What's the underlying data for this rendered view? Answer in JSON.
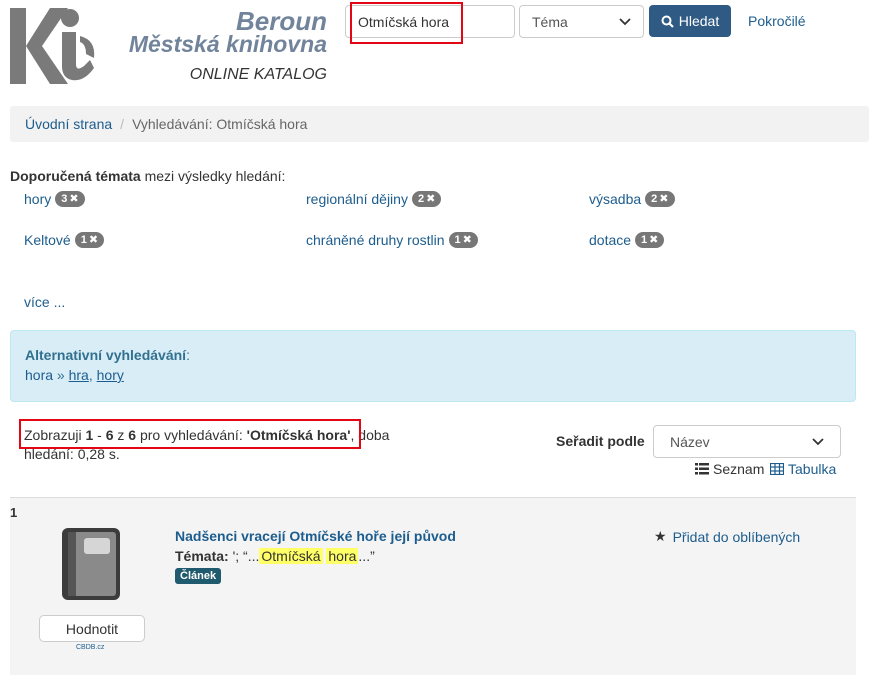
{
  "brand": {
    "city": "Beroun",
    "library": "Městská knihovna",
    "subtitle": "ONLINE KATALOG"
  },
  "search": {
    "query": "Otmíčská hora",
    "index_selected": "Téma",
    "submit_label": "Hledat",
    "advanced_label": "Pokročilé"
  },
  "breadcrumb": {
    "home": "Úvodní strana",
    "separator": "/",
    "current": "Vyhledávání: Otmíčská hora"
  },
  "suggested_topics": {
    "title_bold": "Doporučená témata",
    "title_rest": " mezi výsledky hledání:",
    "items": [
      {
        "label": "hory",
        "count": "3"
      },
      {
        "label": "regionální dějiny",
        "count": "2"
      },
      {
        "label": "výsadba",
        "count": "2"
      },
      {
        "label": "Keltové",
        "count": "1"
      },
      {
        "label": "chráněné druhy rostlin",
        "count": "1"
      },
      {
        "label": "dotace",
        "count": "1"
      }
    ],
    "more_label": "více ..."
  },
  "alternative_search": {
    "title": "Alternativní vyhledávání",
    "title_suffix": ":",
    "source": "hora",
    "arrow": "»",
    "suggestions": [
      "hra",
      "hory"
    ]
  },
  "results_summary": {
    "prefix": "Zobrazuji ",
    "from": "1",
    "dash": " - ",
    "to": "6",
    "of_word": " z ",
    "total": "6",
    "for_word": " pro vyhledávání: ",
    "query_quoted": "'Otmíčská hora'",
    "time_text": ", doba hledání: 0,28 s."
  },
  "sort": {
    "label": "Seřadit podle",
    "selected": "Název"
  },
  "view_modes": {
    "list_label": "Seznam",
    "table_label": "Tabulka"
  },
  "results": [
    {
      "number": "1",
      "title": "Nadšenci vracejí Otmíčské hoře její původ",
      "topics_label": "Témata:",
      "topics_prefix": " '; “...",
      "highlight_1": "Otmíčská",
      "highlight_2": "hora",
      "topics_suffix": "...”",
      "type": "Článek",
      "rate_label": "Hodnotit",
      "rating_source": "CBDB.cz",
      "favorite_label": "Přidat do oblíbených"
    }
  ],
  "colors": {
    "primary": "#2e5a84",
    "link": "#1d5d8e",
    "info_bg": "#d9edf7",
    "highlight": "#ffff66",
    "annotation_box": "#e30613"
  }
}
